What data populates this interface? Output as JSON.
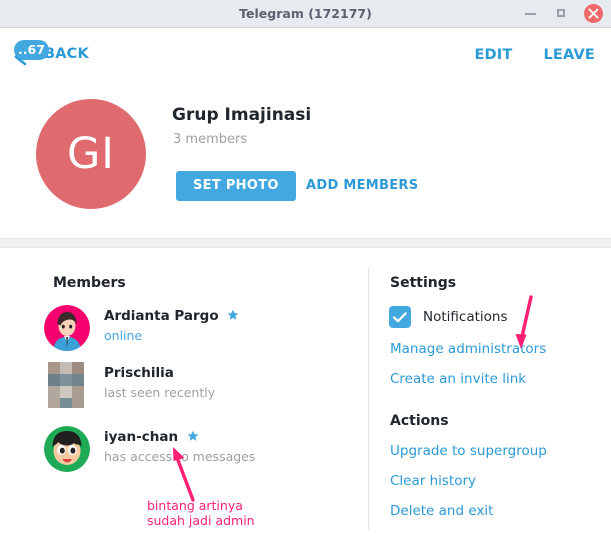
{
  "window": {
    "title": "Telegram (172177)",
    "controls": {
      "minimize": "minimize-button",
      "maximize": "maximize-button",
      "close": "close-button"
    }
  },
  "actionbar": {
    "back_label": "BACK",
    "unread_badge": "..67",
    "edit_label": "EDIT",
    "leave_label": "LEAVE"
  },
  "group": {
    "avatar_initials": "GI",
    "avatar_color": "#e06b6f",
    "name": "Grup Imajinasi",
    "members_count": "3 members",
    "set_photo_label": "SET PHOTO",
    "add_members_label": "ADD MEMBERS"
  },
  "members": {
    "heading": "Members",
    "list": [
      {
        "name": "Ardianta Pargo",
        "status": "online",
        "status_type": "online",
        "is_admin": true,
        "avatar_color": "#f5006e"
      },
      {
        "name": "Prischilia",
        "status": "last seen recently",
        "status_type": "offline",
        "is_admin": false,
        "avatar_color": "#a79a8f"
      },
      {
        "name": "iyan-chan",
        "status": "has access to messages",
        "status_type": "offline",
        "is_admin": true,
        "avatar_color": "#1faa55"
      }
    ]
  },
  "settings": {
    "heading": "Settings",
    "notifications_label": "Notifications",
    "notifications_checked": true,
    "links": [
      "Manage administrators",
      "Create an invite link"
    ]
  },
  "actions": {
    "heading": "Actions",
    "links": [
      "Upgrade to supergroup",
      "Clear history",
      "Delete and exit"
    ]
  },
  "annotations": {
    "color": "#ff1f73",
    "note_member": "bintang artinya\nsudah jadi admin"
  },
  "theme": {
    "accent_blue": "#44a8e0",
    "link_blue": "#2b9ad6",
    "text_dark": "#20262d",
    "text_muted": "#9aa0a6",
    "titlebar_bg": "#e7eaee",
    "close_red": "#ef6b6b"
  }
}
